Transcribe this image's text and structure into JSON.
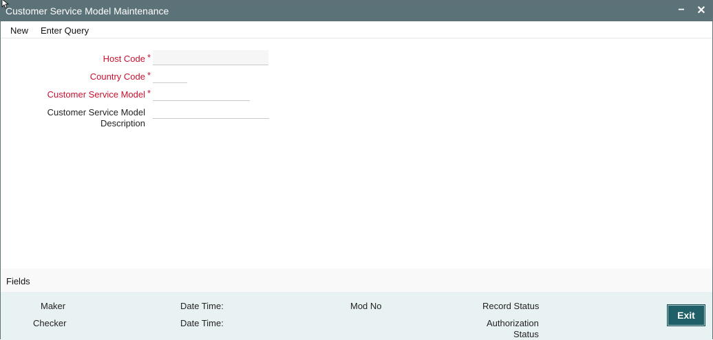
{
  "window": {
    "title": "Customer Service Model Maintenance",
    "minimize_glyph": "−",
    "close_glyph": "✕"
  },
  "menu": {
    "new_label": "New",
    "enter_query_label": "Enter Query"
  },
  "form": {
    "host_code": {
      "label": "Host Code",
      "value": ""
    },
    "country_code": {
      "label": "Country Code",
      "value": ""
    },
    "customer_service_model": {
      "label": "Customer Service Model",
      "value": ""
    },
    "description": {
      "label_line1": "Customer Service Model",
      "label_line2": "Description",
      "value": ""
    },
    "required_mark": "*"
  },
  "fields_bar": {
    "label": "Fields"
  },
  "audit": {
    "maker_label": "Maker",
    "checker_label": "Checker",
    "date_time_label_1": "Date Time:",
    "date_time_label_2": "Date Time:",
    "mod_no_label": "Mod No",
    "record_status_label": "Record Status",
    "authorization_status_line1": "Authorization",
    "authorization_status_line2": "Status"
  },
  "buttons": {
    "exit_label": "Exit"
  },
  "colors": {
    "titlebar": "#5b7378",
    "required": "#c8102e",
    "exit_button": "#1f5f67",
    "audit_bg": "#e9f2f3"
  },
  "icons": {
    "cursor": "cursor-arrow-icon",
    "minimize": "minimize-icon",
    "close": "close-icon"
  }
}
